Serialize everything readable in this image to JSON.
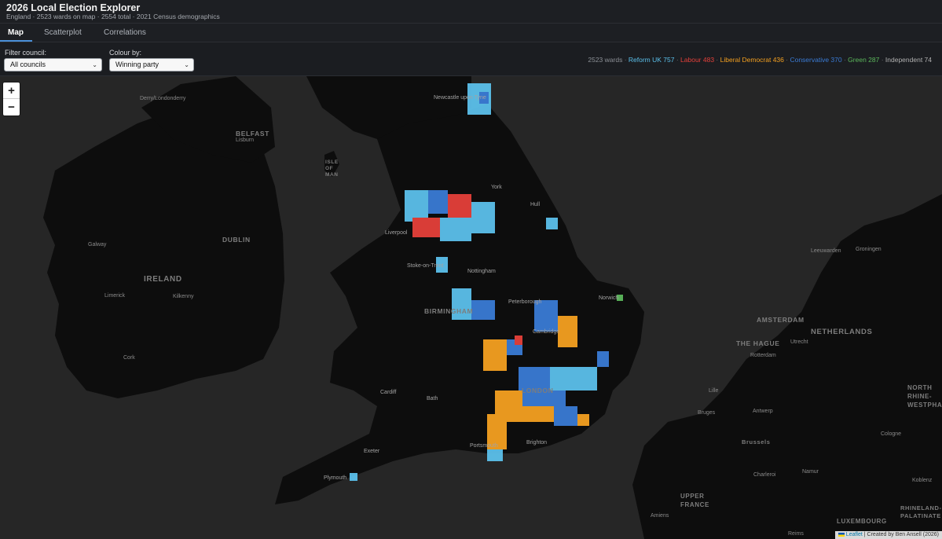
{
  "header": {
    "title": "2026 Local Election Explorer",
    "subtitle": "England · 2523 wards on map · 2554 total · 2021 Census demographics"
  },
  "tabs": [
    {
      "label": "Map",
      "active": true
    },
    {
      "label": "Scatterplot",
      "active": false
    },
    {
      "label": "Correlations",
      "active": false
    }
  ],
  "controls": {
    "filter_label": "Filter council:",
    "filter_value": "All councils",
    "colour_label": "Colour by:",
    "colour_value": "Winning party"
  },
  "counts": {
    "wards": "2523 wards",
    "parties": [
      {
        "label": "Reform UK 757",
        "color": "#5bc0eb"
      },
      {
        "label": "Labour 483",
        "color": "#e4403a"
      },
      {
        "label": "Liberal Democrat 436",
        "color": "#f4a020"
      },
      {
        "label": "Conservative 370",
        "color": "#3a7bd5"
      },
      {
        "label": "Green 287",
        "color": "#5cb85c"
      },
      {
        "label": "Independent 74",
        "color": "#b0b0b0"
      }
    ]
  },
  "map": {
    "zoom_in": "+",
    "zoom_out": "−",
    "places": [
      "Newcastle upon Tyne",
      "Derry/Londonderry",
      "BELFAST",
      "Lisburn",
      "ISLE OF MAN",
      "York",
      "Hull",
      "Liverpool",
      "Stoke-on-Trent",
      "Nottingham",
      "DUBLIN",
      "Galway",
      "IRELAND",
      "Limerick",
      "Kilkenny",
      "Cork",
      "Peterborough",
      "Norwich",
      "BIRMINGHAM",
      "Cambridge",
      "Cardiff",
      "Bath",
      "LONDON",
      "Brighton",
      "Portsmouth",
      "Exeter",
      "Plymouth",
      "AMSTERDAM",
      "THE HAGUE",
      "Utrecht",
      "NETHERLANDS",
      "Rotterdam",
      "Leeuwarden",
      "Groningen",
      "Antwerp",
      "Bruges",
      "Brussels",
      "Cologne",
      "NORTH RHINE-WESTPHALIA",
      "Charleroi",
      "Namur",
      "Koblenz",
      "Lille",
      "Reims",
      "UPPER FRANCE",
      "Amiens",
      "LUXEMBOURG",
      "RHINELAND-PALATINATE"
    ],
    "attribution_leaflet": "Leaflet",
    "attribution_credit": "Created by Ben Ansell (2026)"
  }
}
